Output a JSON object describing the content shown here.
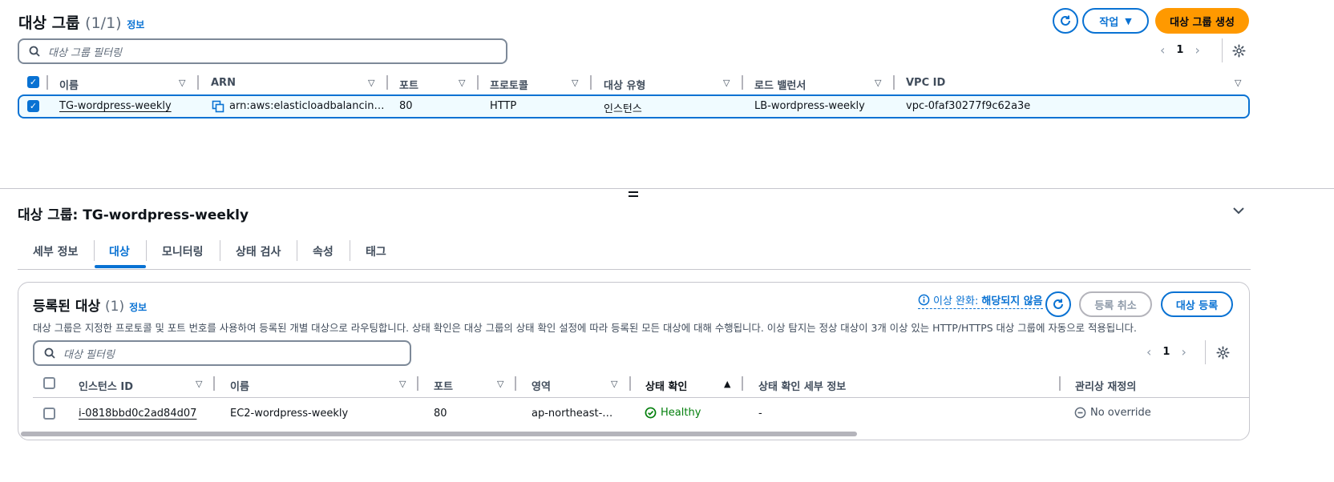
{
  "header": {
    "title": "대상 그룹",
    "count": "(1/1)",
    "info": "정보",
    "actions_label": "작업",
    "create_label": "대상 그룹 생성",
    "filter_placeholder": "대상 그룹 필터링",
    "page": "1"
  },
  "tg_table": {
    "columns": [
      "이름",
      "ARN",
      "포트",
      "프로토콜",
      "대상 유형",
      "로드 밸런서",
      "VPC ID"
    ],
    "row": {
      "name": "TG-wordpress-weekly",
      "arn": "arn:aws:elasticloadbalancin…",
      "port": "80",
      "protocol": "HTTP",
      "target_type": "인스턴스",
      "load_balancer": "LB-wordpress-weekly",
      "vpc_id": "vpc-0faf30277f9c62a3e"
    }
  },
  "details": {
    "title": "대상 그룹: TG-wordpress-weekly",
    "tabs": [
      "세부 정보",
      "대상",
      "모니터링",
      "상태 검사",
      "속성",
      "태그"
    ],
    "active_tab": "대상"
  },
  "targets": {
    "title": "등록된 대상",
    "count": "(1)",
    "info": "정보",
    "anomaly_prefix": "이상 완화:",
    "anomaly_value": "해당되지 않음",
    "deregister_label": "등록 취소",
    "register_label": "대상 등록",
    "description": "대상 그룹은 지정한 프로토콜 및 포트 번호를 사용하여 등록된 개별 대상으로 라우팅합니다. 상태 확인은 대상 그룹의 상태 확인 설정에 따라 등록된 모든 대상에 대해 수행됩니다. 이상 탐지는 정상 대상이 3개 이상 있는 HTTP/HTTPS 대상 그룹에 자동으로 적용됩니다.",
    "filter_placeholder": "대상 필터링",
    "page": "1",
    "columns": [
      "인스턴스 ID",
      "이름",
      "포트",
      "영역",
      "상태 확인",
      "상태 확인 세부 정보",
      "관리상 재정의"
    ],
    "row": {
      "instance_id": "i-0818bbd0c2ad84d07",
      "name": "EC2-wordpress-weekly",
      "port": "80",
      "zone": "ap-northeast-…",
      "health": "Healthy",
      "health_detail": "-",
      "override": "No override"
    }
  },
  "colors": {
    "link": "#0972d3",
    "primary": "#ff9900",
    "healthy": "#037f0c"
  }
}
